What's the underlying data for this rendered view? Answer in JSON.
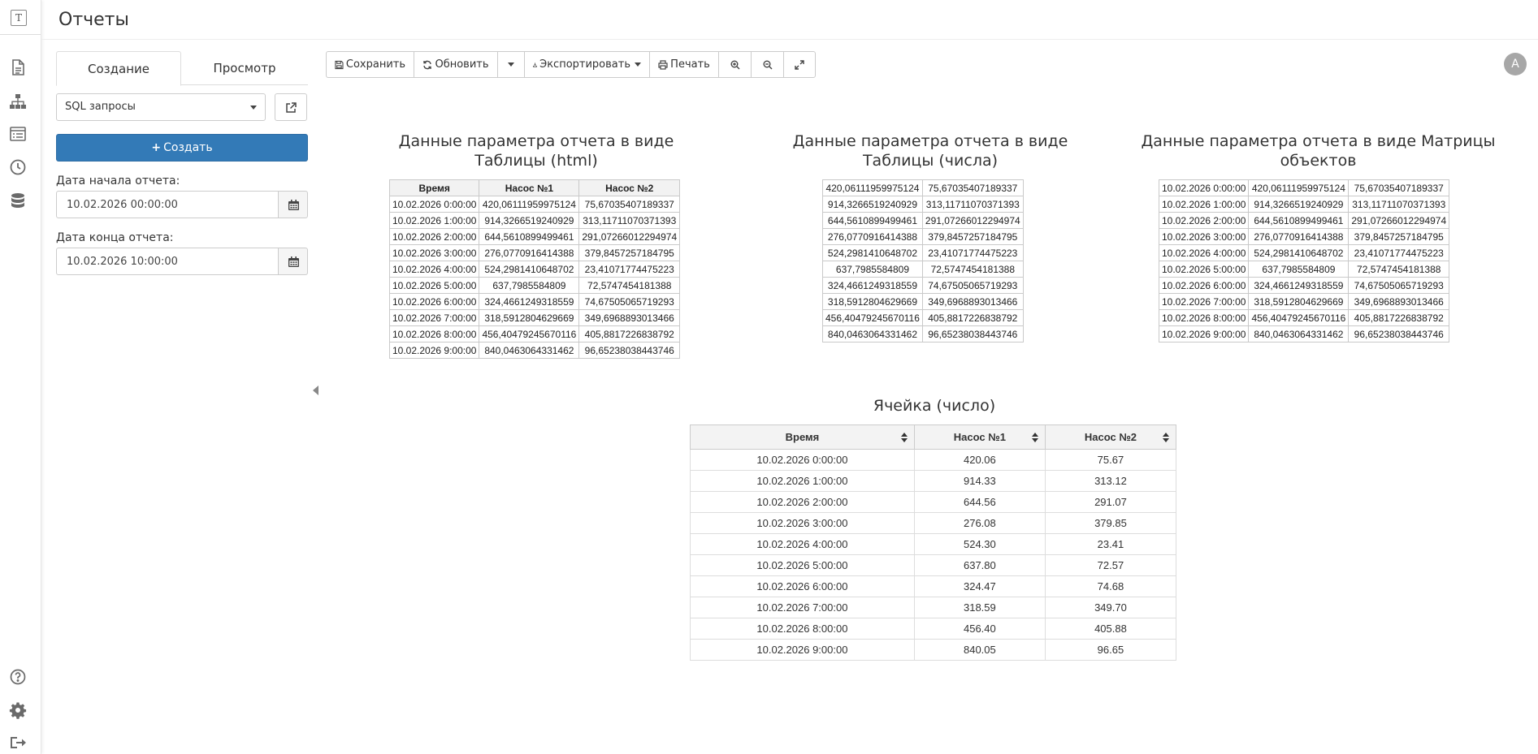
{
  "app": {
    "logo": "T",
    "title": "Отчеты"
  },
  "rail": {
    "top_icons": [
      "document-icon",
      "sitemap-icon",
      "list-icon",
      "clock-icon",
      "database-icon"
    ],
    "bottom_icons": [
      "help-icon",
      "gear-icon",
      "logout-icon"
    ]
  },
  "tabs": [
    {
      "label": "Создание",
      "active": true
    },
    {
      "label": "Просмотр",
      "active": false
    }
  ],
  "query_select": {
    "value": "SQL запросы"
  },
  "create_button": {
    "label": "Создать"
  },
  "start_date": {
    "label": "Дата начала отчета:",
    "value": "10.02.2026 00:00:00"
  },
  "end_date": {
    "label": "Дата конца отчета:",
    "value": "10.02.2026 10:00:00"
  },
  "toolbar": {
    "save": "Сохранить",
    "refresh": "Обновить",
    "export": "Экспортировать",
    "print": "Печать"
  },
  "avatar": {
    "initial": "A"
  },
  "reports": {
    "html_table": {
      "title": "Данные параметра отчета в виде Таблицы (html)",
      "headers": [
        "Время",
        "Насос №1",
        "Насос №2"
      ],
      "rows": [
        [
          "10.02.2026 0:00:00",
          "420,06111959975124",
          "75,67035407189337"
        ],
        [
          "10.02.2026 1:00:00",
          "914,3266519240929",
          "313,11711070371393"
        ],
        [
          "10.02.2026 2:00:00",
          "644,5610899499461",
          "291,07266012294974"
        ],
        [
          "10.02.2026 3:00:00",
          "276,0770916414388",
          "379,8457257184795"
        ],
        [
          "10.02.2026 4:00:00",
          "524,2981410648702",
          "23,41071774475223"
        ],
        [
          "10.02.2026 5:00:00",
          "637,7985584809",
          "72,5747454181388"
        ],
        [
          "10.02.2026 6:00:00",
          "324,4661249318559",
          "74,67505065719293"
        ],
        [
          "10.02.2026 7:00:00",
          "318,5912804629669",
          "349,6968893013466"
        ],
        [
          "10.02.2026 8:00:00",
          "456,40479245670116",
          "405,8817226838792"
        ],
        [
          "10.02.2026 9:00:00",
          "840,0463064331462",
          "96,65238038443746"
        ]
      ]
    },
    "number_table": {
      "title": "Данные параметра отчета в виде Таблицы (числа)",
      "rows": [
        [
          "420,06111959975124",
          "75,67035407189337"
        ],
        [
          "914,3266519240929",
          "313,11711070371393"
        ],
        [
          "644,5610899499461",
          "291,07266012294974"
        ],
        [
          "276,0770916414388",
          "379,8457257184795"
        ],
        [
          "524,2981410648702",
          "23,41071774475223"
        ],
        [
          "637,7985584809",
          "72,5747454181388"
        ],
        [
          "324,4661249318559",
          "74,67505065719293"
        ],
        [
          "318,5912804629669",
          "349,6968893013466"
        ],
        [
          "456,40479245670116",
          "405,8817226838792"
        ],
        [
          "840,0463064331462",
          "96,65238038443746"
        ]
      ]
    },
    "matrix_table": {
      "title": "Данные параметра отчета в виде Матрицы объектов",
      "rows": [
        [
          "10.02.2026 0:00:00",
          "420,06111959975124",
          "75,67035407189337"
        ],
        [
          "10.02.2026 1:00:00",
          "914,3266519240929",
          "313,11711070371393"
        ],
        [
          "10.02.2026 2:00:00",
          "644,5610899499461",
          "291,07266012294974"
        ],
        [
          "10.02.2026 3:00:00",
          "276,0770916414388",
          "379,8457257184795"
        ],
        [
          "10.02.2026 4:00:00",
          "524,2981410648702",
          "23,41071774475223"
        ],
        [
          "10.02.2026 5:00:00",
          "637,7985584809",
          "72,5747454181388"
        ],
        [
          "10.02.2026 6:00:00",
          "324,4661249318559",
          "74,67505065719293"
        ],
        [
          "10.02.2026 7:00:00",
          "318,5912804629669",
          "349,6968893013466"
        ],
        [
          "10.02.2026 8:00:00",
          "456,40479245670116",
          "405,8817226838792"
        ],
        [
          "10.02.2026 9:00:00",
          "840,0463064331462",
          "96,65238038443746"
        ]
      ]
    },
    "cell_table": {
      "title": "Ячейка (число)",
      "headers": [
        "Время",
        "Насос №1",
        "Насос №2"
      ],
      "rows": [
        [
          "10.02.2026 0:00:00",
          "420.06",
          "75.67"
        ],
        [
          "10.02.2026 1:00:00",
          "914.33",
          "313.12"
        ],
        [
          "10.02.2026 2:00:00",
          "644.56",
          "291.07"
        ],
        [
          "10.02.2026 3:00:00",
          "276.08",
          "379.85"
        ],
        [
          "10.02.2026 4:00:00",
          "524.30",
          "23.41"
        ],
        [
          "10.02.2026 5:00:00",
          "637.80",
          "72.57"
        ],
        [
          "10.02.2026 6:00:00",
          "324.47",
          "74.68"
        ],
        [
          "10.02.2026 7:00:00",
          "318.59",
          "349.70"
        ],
        [
          "10.02.2026 8:00:00",
          "456.40",
          "405.88"
        ],
        [
          "10.02.2026 9:00:00",
          "840.05",
          "96.65"
        ]
      ]
    }
  }
}
